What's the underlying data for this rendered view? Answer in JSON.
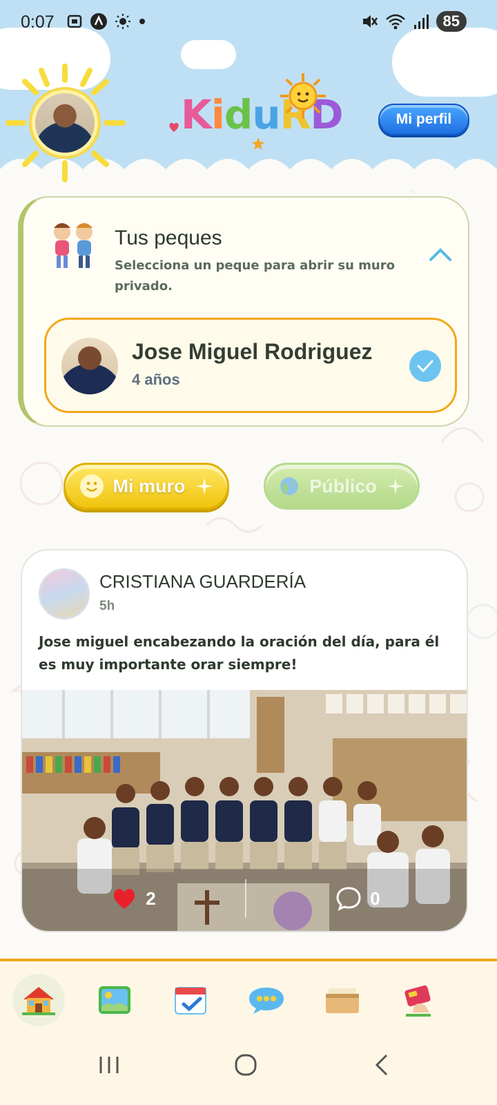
{
  "status_bar": {
    "time": "0:07",
    "battery": "85",
    "icons_left": [
      "screenshot-icon",
      "a-badge-icon",
      "brightness-icon",
      "dot-icon"
    ],
    "icons_right": [
      "mute-icon",
      "wifi-icon",
      "signal-icon"
    ]
  },
  "header": {
    "logo_text": [
      "K",
      "i",
      "d",
      "u",
      "R",
      "D"
    ],
    "profile_button": "Mi perfil"
  },
  "peques": {
    "title": "Tus peques",
    "subtitle": "Selecciona un peque para abrir su muro privado.",
    "children": [
      {
        "name": "Jose Miguel Rodriguez",
        "age": "4 años",
        "selected": true
      }
    ]
  },
  "wall_toggle": {
    "mine": "Mi muro",
    "public": "Público",
    "active": "mine"
  },
  "posts": [
    {
      "author": "CRISTIANA GUARDERÍA",
      "time": "5h",
      "text": "Jose miguel encabezando la oración del día, para él es muy importante orar siempre!",
      "likes": "2",
      "comments": "0"
    }
  ],
  "bottom_nav": {
    "items": [
      "home-icon",
      "album-icon",
      "calendar-icon",
      "chat-icon",
      "box-icon",
      "card-icon"
    ],
    "active": "home-icon"
  },
  "colors": {
    "header_sky": "#bfe0f4",
    "accent_orange": "#f2a81c",
    "profile_blue": "#1f6fe0",
    "muro_yellow": "#f0c40e",
    "publico_green": "#b3d98a",
    "check_blue": "#6cc4f0"
  }
}
